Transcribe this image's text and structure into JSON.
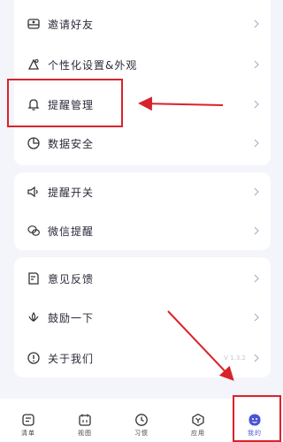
{
  "colors": {
    "accent": "#4a54d8",
    "annotation": "#d8232a",
    "background": "#f4f4fb"
  },
  "menu": {
    "group1": [
      {
        "icon": "invite-friend-icon",
        "label": "邀请好友"
      },
      {
        "icon": "personalize-icon",
        "label": "个性化设置&外观"
      },
      {
        "icon": "bell-icon",
        "label": "提醒管理"
      },
      {
        "icon": "pie-chart-icon",
        "label": "数据安全"
      }
    ],
    "group2": [
      {
        "icon": "speaker-icon",
        "label": "提醒开关"
      },
      {
        "icon": "wechat-icon",
        "label": "微信提醒"
      }
    ],
    "group3": [
      {
        "icon": "feedback-icon",
        "label": "意见反馈"
      },
      {
        "icon": "lotus-icon",
        "label": "鼓励一下"
      },
      {
        "icon": "info-icon",
        "label": "关于我们",
        "version": "V 1.3.2"
      }
    ]
  },
  "tabbar": [
    {
      "icon": "list-icon",
      "label": "清单"
    },
    {
      "icon": "calendar-icon",
      "label": "视图"
    },
    {
      "icon": "clock-icon",
      "label": "习惯"
    },
    {
      "icon": "apps-icon",
      "label": "应用"
    },
    {
      "icon": "profile-icon",
      "label": "我的",
      "active": true
    }
  ]
}
